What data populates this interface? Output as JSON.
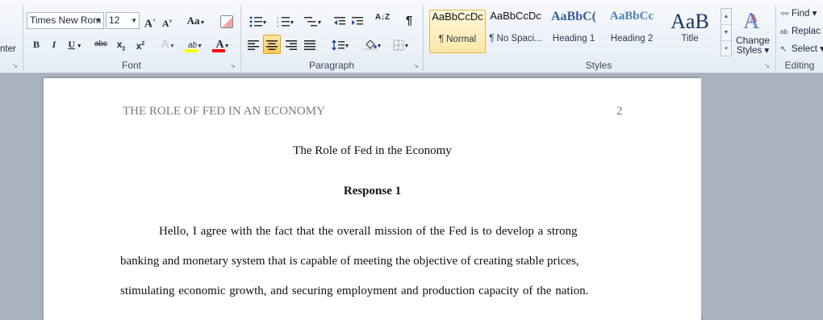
{
  "ribbon": {
    "clipboard": {
      "partial_label": "nter"
    },
    "font": {
      "group_label": "Font",
      "font_name": "Times New Rom",
      "font_size": "12",
      "grow_label": "A",
      "shrink_label": "A",
      "change_case_label": "Aa",
      "bold": "B",
      "italic": "I",
      "underline": "U",
      "strike": "abc",
      "subscript": "x",
      "subscript_mark": "2",
      "superscript": "x",
      "superscript_mark": "2",
      "text_effects": "A",
      "highlight": "ab",
      "font_color": "A",
      "highlight_color": "#ffff00",
      "font_color_bar": "#ff0000"
    },
    "paragraph": {
      "group_label": "Paragraph",
      "show_marks": "¶",
      "sort": "A↓Z"
    },
    "styles": {
      "group_label": "Styles",
      "items": [
        {
          "preview": "AaBbCcDc",
          "name": "¶ Normal",
          "selected": true
        },
        {
          "preview": "AaBbCcDc",
          "name": "¶ No Spaci...",
          "selected": false
        },
        {
          "preview": "AaBbC(",
          "name": "Heading 1",
          "selected": false
        },
        {
          "preview": "AaBbCc",
          "name": "Heading 2",
          "selected": false
        },
        {
          "preview": "AaB",
          "name": "Title",
          "selected": false
        }
      ],
      "change_styles_line1": "Change",
      "change_styles_line2": "Styles ▾"
    },
    "editing": {
      "group_label": "Editing",
      "find": "Find ▾",
      "replace": "Replac",
      "select": "Select ▾"
    }
  },
  "document": {
    "header_left": "THE ROLE OF FED IN AN ECONOMY",
    "page_number": "2",
    "title": "The Role of Fed in the Economy",
    "subheading": "Response 1",
    "lines": [
      "Hello, I agree with the fact that the overall mission of the Fed is to develop a strong",
      "banking and monetary system that is capable of meeting the objective of creating stable prices,",
      "stimulating economic growth, and securing employment and production capacity of the nation."
    ]
  }
}
